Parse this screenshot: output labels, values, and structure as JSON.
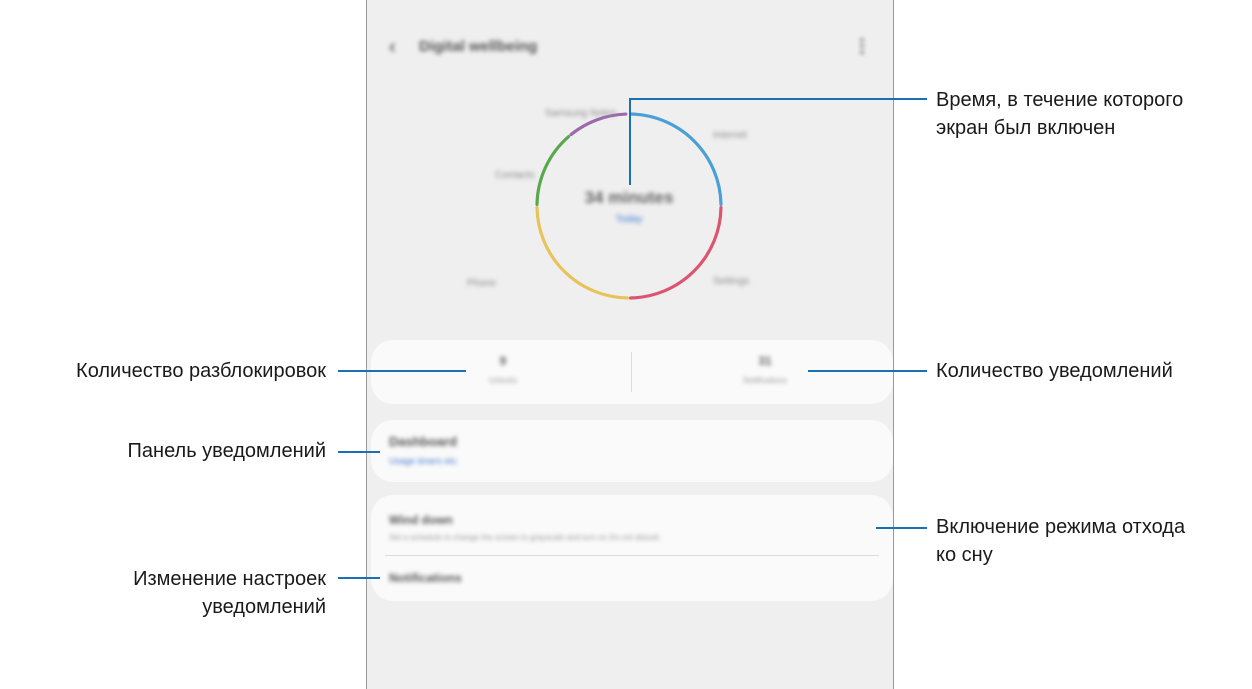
{
  "screen": {
    "appbar": {
      "back_icon": "chevron-left-icon",
      "title": "Digital wellbeing",
      "more_icon": "more-vertical-icon"
    },
    "chart": {
      "center_time": "34 minutes",
      "center_day": "Today",
      "app_labels": [
        "Internet",
        "Contacts",
        "Phone",
        "Settings",
        "Samsung Notes"
      ],
      "segment_colors": [
        "#4a9fd6",
        "#dd5470",
        "#e8c35a",
        "#5aa84e",
        "#9b6aae"
      ]
    },
    "stats": {
      "unlocks": {
        "value": "9",
        "caption": "Unlocks"
      },
      "notifications": {
        "value": "31",
        "caption": "Notifications"
      }
    },
    "dashboard": {
      "title": "Dashboard",
      "subtitle": "Usage timers etc."
    },
    "wind_down": {
      "title": "Wind down",
      "subtitle": "Set a schedule to change the screen to grayscale and turn on Do not disturb."
    },
    "notifications_item": {
      "title": "Notifications"
    }
  },
  "callouts": {
    "screen_time_line1": "Время, в течение которого",
    "screen_time_line2": "экран был включен",
    "unlocks": "Количество разблокировок",
    "notifications": "Количество уведомлений",
    "dashboard": "Панель уведомлений",
    "wind_down_line1": "Включение режима отхода",
    "wind_down_line2": "ко сну",
    "notif_settings_line1": "Изменение настроек",
    "notif_settings_line2": "уведомлений"
  },
  "colors": {
    "accent_blue": "#3f79d4",
    "callout_line": "#1a6fb5"
  }
}
